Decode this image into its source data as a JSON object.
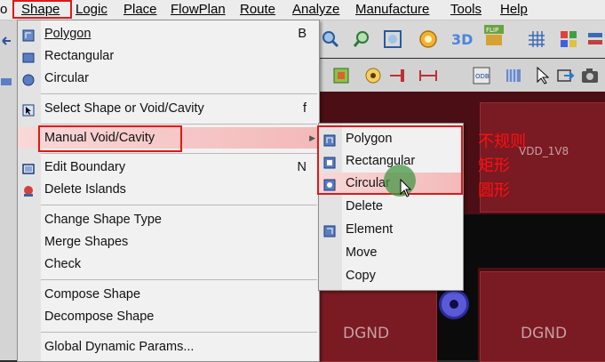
{
  "menubar": {
    "items": [
      "Shape",
      "Logic",
      "Place",
      "FlowPlan",
      "Route",
      "Analyze",
      "Manufacture",
      "Tools",
      "Help"
    ]
  },
  "shape_menu": {
    "items": [
      {
        "label": "Polygon",
        "shortcut": "B",
        "icon": "polygon-shape-icon"
      },
      {
        "label": "Rectangular",
        "shortcut": "",
        "icon": "rectangle-shape-icon"
      },
      {
        "label": "Circular",
        "shortcut": "",
        "icon": "circle-shape-icon"
      },
      {
        "label": "Select Shape or Void/Cavity",
        "shortcut": "f",
        "icon": "select-shape-icon"
      },
      {
        "label": "Manual Void/Cavity",
        "shortcut": "",
        "icon": ""
      },
      {
        "label": "Edit Boundary",
        "shortcut": "N",
        "icon": "edit-boundary-icon"
      },
      {
        "label": "Delete Islands",
        "shortcut": "",
        "icon": "delete-islands-icon"
      },
      {
        "label": "Change Shape Type",
        "shortcut": "",
        "icon": ""
      },
      {
        "label": "Merge Shapes",
        "shortcut": "",
        "icon": ""
      },
      {
        "label": "Check",
        "shortcut": "",
        "icon": ""
      },
      {
        "label": "Compose Shape",
        "shortcut": "",
        "icon": ""
      },
      {
        "label": "Decompose Shape",
        "shortcut": "",
        "icon": ""
      },
      {
        "label": "Global Dynamic Params...",
        "shortcut": "",
        "icon": ""
      }
    ]
  },
  "void_submenu": {
    "items": [
      {
        "label": "Polygon",
        "icon": "void-polygon-icon"
      },
      {
        "label": "Rectangular",
        "icon": "void-rectangle-icon"
      },
      {
        "label": "Circular",
        "icon": "void-circle-icon"
      },
      {
        "label": "Delete",
        "icon": ""
      },
      {
        "label": "Element",
        "icon": "void-element-icon"
      },
      {
        "label": "Move",
        "icon": ""
      },
      {
        "label": "Copy",
        "icon": ""
      }
    ]
  },
  "annotations": [
    "不规则",
    "矩形",
    "圆形"
  ],
  "canvas": {
    "net_label": "VDD_1V8",
    "pad_labels": [
      "DGND",
      "DGND"
    ]
  },
  "colors": {
    "annotation_red": "#e01818",
    "highlight": "#f3b9b9",
    "canvas_bg": "#4a0e14"
  }
}
